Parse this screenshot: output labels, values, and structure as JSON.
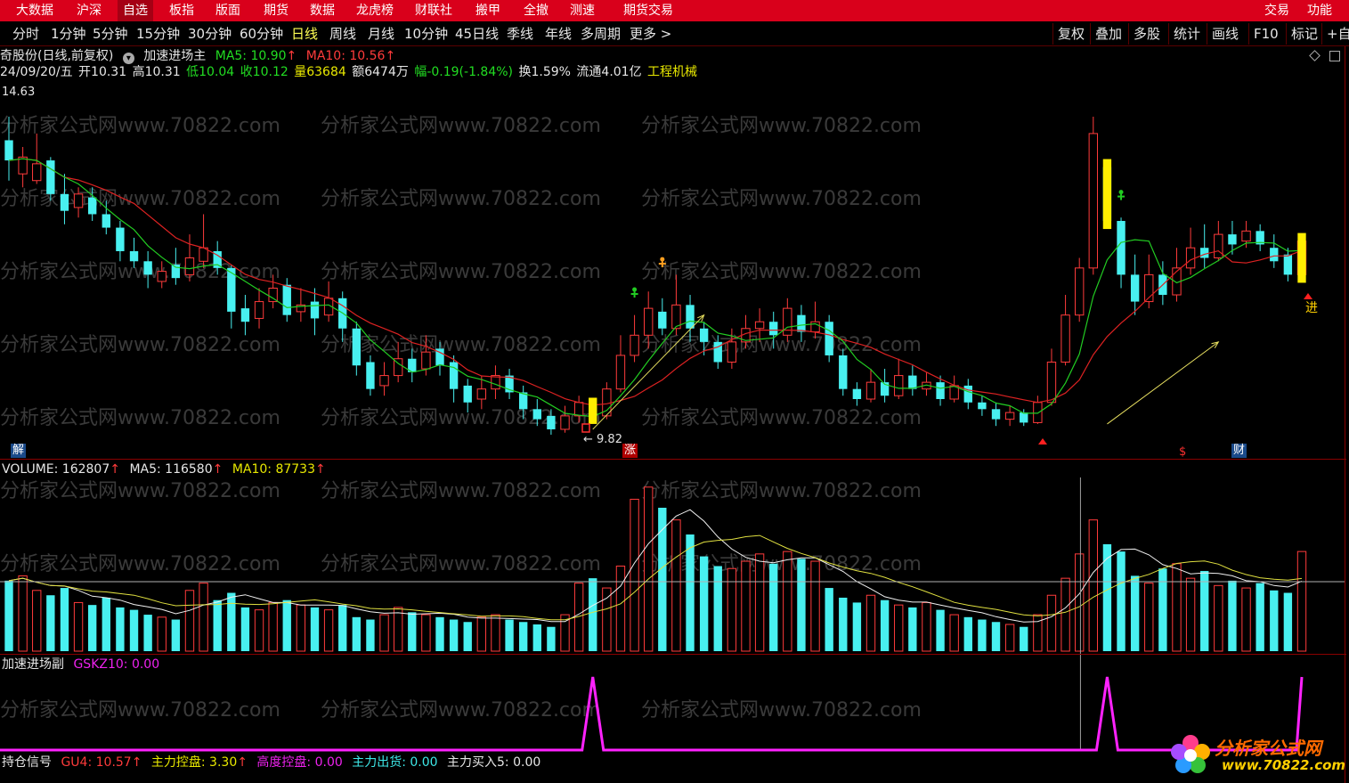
{
  "top_menu": [
    "大数据",
    "沪深",
    "自选",
    "板指",
    "版面",
    "期货",
    "数据",
    "龙虎榜",
    "财联社",
    "搬甲",
    "全撤",
    "测速",
    "期货交易"
  ],
  "top_menu_active": "自选",
  "top_right": [
    "交易",
    "功能"
  ],
  "periods": [
    "分时",
    "1分钟",
    "5分钟",
    "15分钟",
    "30分钟",
    "60分钟",
    "日线",
    "周线",
    "月线",
    "10分钟",
    "45日线",
    "季线",
    "年线",
    "多周期",
    "更多 >"
  ],
  "period_active": "日线",
  "toolbar_right": [
    "复权",
    "叠加",
    "多股",
    "统计",
    "画线",
    "F10",
    "标记",
    "+自"
  ],
  "stock_header": {
    "name": "奇股份(日线,前复权)",
    "indicator": "加速进场主",
    "ma5": "MA5: 10.90",
    "ma10": "MA10: 10.56"
  },
  "quote": {
    "date": "24/09/20/五",
    "open": "开10.31",
    "high": "高10.31",
    "low": "低10.04",
    "close": "收10.12",
    "volume": "量63684",
    "amount": "额6474万",
    "change": "幅-0.19(-1.84%)",
    "turnover": "换1.59%",
    "float_cap": "流通4.01亿",
    "industry": "工程机械"
  },
  "price_high": "14.63",
  "low_mark": "← 9.82",
  "markers": {
    "jie": "解",
    "zhang": "涨",
    "jin": "进",
    "cai": "财",
    "dollar": "$"
  },
  "volume_header": {
    "volume": "VOLUME: 162807",
    "ma5": "MA5: 116580",
    "ma10": "MA10: 87733"
  },
  "sub_header": {
    "name": "加速进场副",
    "gskz": "GSKZ10: 0.00"
  },
  "bottom_header": {
    "name": "持仓信号",
    "gu4": "GU4: 10.57",
    "zlkp": "主力控盘: 3.30",
    "gdkp": "高度控盘: 0.00",
    "zlch": "主力出货: 0.00",
    "zlmr": "主力买入5: 0.00"
  },
  "watermark": "分析家公式网www.70822.com",
  "logo": {
    "title": "分析家公式网",
    "url": "www.70822.com"
  },
  "colors": {
    "up": "#ff3b3b",
    "down": "#48f0f0",
    "ma5": "#22cc22",
    "ma10": "#dd2222",
    "signal": "#ff22ff",
    "menu_bg": "#d9001b"
  },
  "chart_data": {
    "type": "candlestick",
    "price_range": [
      9.82,
      14.63
    ],
    "candles": [
      [
        14.2,
        13.9,
        14.55,
        13.6
      ],
      [
        13.7,
        13.95,
        14.1,
        13.5
      ],
      [
        13.6,
        13.85,
        14.3,
        13.55
      ],
      [
        13.9,
        13.4,
        13.95,
        13.3
      ],
      [
        13.4,
        13.15,
        13.7,
        12.95
      ],
      [
        13.2,
        13.4,
        13.5,
        13.05
      ],
      [
        13.35,
        13.1,
        13.5,
        13.0
      ],
      [
        13.1,
        12.9,
        13.3,
        12.8
      ],
      [
        12.9,
        12.55,
        13.0,
        12.4
      ],
      [
        12.55,
        12.4,
        12.75,
        12.3
      ],
      [
        12.4,
        12.2,
        12.55,
        12.0
      ],
      [
        12.1,
        12.25,
        12.4,
        12.0
      ],
      [
        12.35,
        12.15,
        12.6,
        12.05
      ],
      [
        12.2,
        12.45,
        12.8,
        12.1
      ],
      [
        12.4,
        12.6,
        13.1,
        12.3
      ],
      [
        12.55,
        12.3,
        12.7,
        12.2
      ],
      [
        12.3,
        11.65,
        12.35,
        11.4
      ],
      [
        11.7,
        11.5,
        11.9,
        11.3
      ],
      [
        11.55,
        11.8,
        12.0,
        11.4
      ],
      [
        11.8,
        12.0,
        12.2,
        11.7
      ],
      [
        12.05,
        11.6,
        12.15,
        11.5
      ],
      [
        11.65,
        11.75,
        12.0,
        11.5
      ],
      [
        11.8,
        11.55,
        12.0,
        11.3
      ],
      [
        11.6,
        11.85,
        12.1,
        11.5
      ],
      [
        11.85,
        11.4,
        11.95,
        11.2
      ],
      [
        11.4,
        10.85,
        11.5,
        10.7
      ],
      [
        10.9,
        10.5,
        11.0,
        10.4
      ],
      [
        10.55,
        10.7,
        10.9,
        10.4
      ],
      [
        10.7,
        10.95,
        11.2,
        10.6
      ],
      [
        10.95,
        10.75,
        11.1,
        10.6
      ],
      [
        10.8,
        11.05,
        11.3,
        10.7
      ],
      [
        11.1,
        10.85,
        11.2,
        10.7
      ],
      [
        10.9,
        10.5,
        11.0,
        10.3
      ],
      [
        10.55,
        10.3,
        10.65,
        10.15
      ],
      [
        10.35,
        10.5,
        10.7,
        10.2
      ],
      [
        10.5,
        10.7,
        10.85,
        10.35
      ],
      [
        10.7,
        10.45,
        10.8,
        10.35
      ],
      [
        10.45,
        10.2,
        10.55,
        10.05
      ],
      [
        10.2,
        10.05,
        10.35,
        9.95
      ],
      [
        10.1,
        9.9,
        10.2,
        9.82
      ],
      [
        9.9,
        10.1,
        10.25,
        9.85
      ],
      [
        10.1,
        10.3,
        10.4,
        10.0
      ],
      [
        10.25,
        10.1,
        10.35,
        10.0
      ],
      [
        10.1,
        10.5,
        10.6,
        10.05
      ],
      [
        10.5,
        11.0,
        11.3,
        10.45
      ],
      [
        11.0,
        11.3,
        11.6,
        10.9
      ],
      [
        11.3,
        11.7,
        11.95,
        11.1
      ],
      [
        11.65,
        11.4,
        11.85,
        11.3
      ],
      [
        11.4,
        11.75,
        12.2,
        11.3
      ],
      [
        11.75,
        11.4,
        11.9,
        11.2
      ],
      [
        11.4,
        11.2,
        11.5,
        11.0
      ],
      [
        11.2,
        10.9,
        11.3,
        10.8
      ],
      [
        10.9,
        11.2,
        11.4,
        10.8
      ],
      [
        11.2,
        11.4,
        11.6,
        11.1
      ],
      [
        11.4,
        11.5,
        11.7,
        11.2
      ],
      [
        11.5,
        11.3,
        11.65,
        11.1
      ],
      [
        11.3,
        11.7,
        11.85,
        11.2
      ],
      [
        11.6,
        11.35,
        11.75,
        11.2
      ],
      [
        11.35,
        11.5,
        11.8,
        11.25
      ],
      [
        11.5,
        11.0,
        11.6,
        10.9
      ],
      [
        11.0,
        10.5,
        11.1,
        10.4
      ],
      [
        10.5,
        10.35,
        10.6,
        10.25
      ],
      [
        10.35,
        10.6,
        10.8,
        10.3
      ],
      [
        10.6,
        10.4,
        10.8,
        10.3
      ],
      [
        10.4,
        10.7,
        10.95,
        10.35
      ],
      [
        10.7,
        10.5,
        10.85,
        10.4
      ],
      [
        10.5,
        10.6,
        10.75,
        10.4
      ],
      [
        10.6,
        10.35,
        10.7,
        10.25
      ],
      [
        10.35,
        10.55,
        10.7,
        10.3
      ],
      [
        10.55,
        10.3,
        10.65,
        10.2
      ],
      [
        10.3,
        10.2,
        10.4,
        10.1
      ],
      [
        10.2,
        10.05,
        10.3,
        9.95
      ],
      [
        10.05,
        10.15,
        10.25,
        9.95
      ],
      [
        10.15,
        10.0,
        10.2,
        9.95
      ],
      [
        10.0,
        10.3,
        10.4,
        9.98
      ],
      [
        10.3,
        10.9,
        11.1,
        10.25
      ],
      [
        10.9,
        11.6,
        11.9,
        10.85
      ],
      [
        11.6,
        12.3,
        12.45,
        11.5
      ],
      [
        12.3,
        14.3,
        14.55,
        12.2
      ],
      [
        13.8,
        13.0,
        13.9,
        12.9
      ],
      [
        13.0,
        12.2,
        13.05,
        12.0
      ],
      [
        12.2,
        11.8,
        12.5,
        11.6
      ],
      [
        11.8,
        12.2,
        12.5,
        11.7
      ],
      [
        12.2,
        11.9,
        12.4,
        11.75
      ],
      [
        11.9,
        12.3,
        12.6,
        11.8
      ],
      [
        12.3,
        12.6,
        12.9,
        12.2
      ],
      [
        12.6,
        12.45,
        12.95,
        12.3
      ],
      [
        12.45,
        12.8,
        13.0,
        12.4
      ],
      [
        12.8,
        12.65,
        13.0,
        12.5
      ],
      [
        12.7,
        12.85,
        13.0,
        12.6
      ],
      [
        12.85,
        12.65,
        12.95,
        12.55
      ],
      [
        12.6,
        12.4,
        12.8,
        12.3
      ],
      [
        12.5,
        12.2,
        12.6,
        12.1
      ],
      [
        12.2,
        12.7,
        12.8,
        12.1
      ]
    ],
    "volumes": [
      58,
      62,
      50,
      46,
      52,
      40,
      38,
      44,
      36,
      34,
      30,
      28,
      26,
      50,
      56,
      42,
      48,
      36,
      34,
      40,
      42,
      38,
      36,
      34,
      38,
      28,
      26,
      30,
      36,
      32,
      30,
      28,
      26,
      24,
      28,
      30,
      26,
      24,
      22,
      20,
      30,
      56,
      60,
      52,
      70,
      125,
      135,
      118,
      108,
      96,
      78,
      70,
      68,
      74,
      80,
      72,
      82,
      76,
      74,
      52,
      44,
      40,
      46,
      42,
      38,
      36,
      40,
      34,
      30,
      28,
      26,
      24,
      22,
      20,
      30,
      46,
      60,
      80,
      108,
      88,
      82,
      62,
      56,
      68,
      72,
      60,
      66,
      54,
      58,
      52,
      56,
      50,
      48,
      82
    ],
    "signal_peaks": [
      42,
      79,
      93
    ]
  }
}
